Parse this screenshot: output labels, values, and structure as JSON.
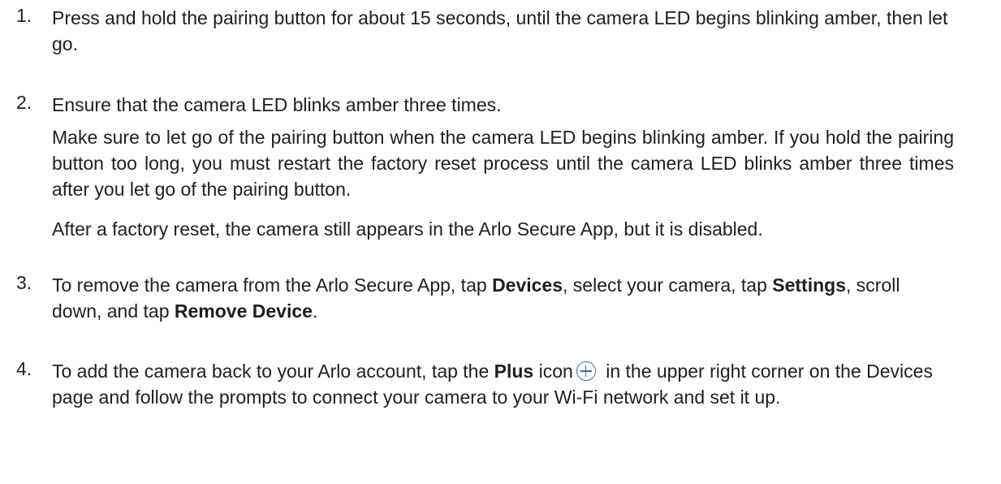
{
  "steps": [
    {
      "number": "1.",
      "text": "Press and hold the pairing button for about 15 seconds, until the camera LED begins blinking amber, then let go."
    },
    {
      "number": "2.",
      "text": "Ensure that the camera LED blinks amber three times.",
      "note1": "Make sure to let go of the pairing button when the camera LED begins blinking amber. If you hold the pairing button too long, you must restart the factory reset process until the camera LED blinks amber three times after you let go of the pairing button.",
      "note2": "After a factory reset, the camera still appears in the Arlo Secure App, but it is disabled."
    },
    {
      "number": "3.",
      "part1": "To remove the camera from the Arlo Secure App, tap ",
      "bold1": "Devices",
      "part2": ", select your camera, tap ",
      "bold2": "Settings",
      "part3": ", scroll down, and tap ",
      "bold3": "Remove Device",
      "part4": "."
    },
    {
      "number": "4.",
      "part1": "To add the camera back to  your Arlo account, tap the ",
      "bold1": "Plus",
      "part2": " icon",
      "icon": "plus-circle-icon",
      "part3": " in the upper right corner on the Devices page and follow the prompts to connect your camera to your Wi-Fi network and set it up."
    }
  ]
}
